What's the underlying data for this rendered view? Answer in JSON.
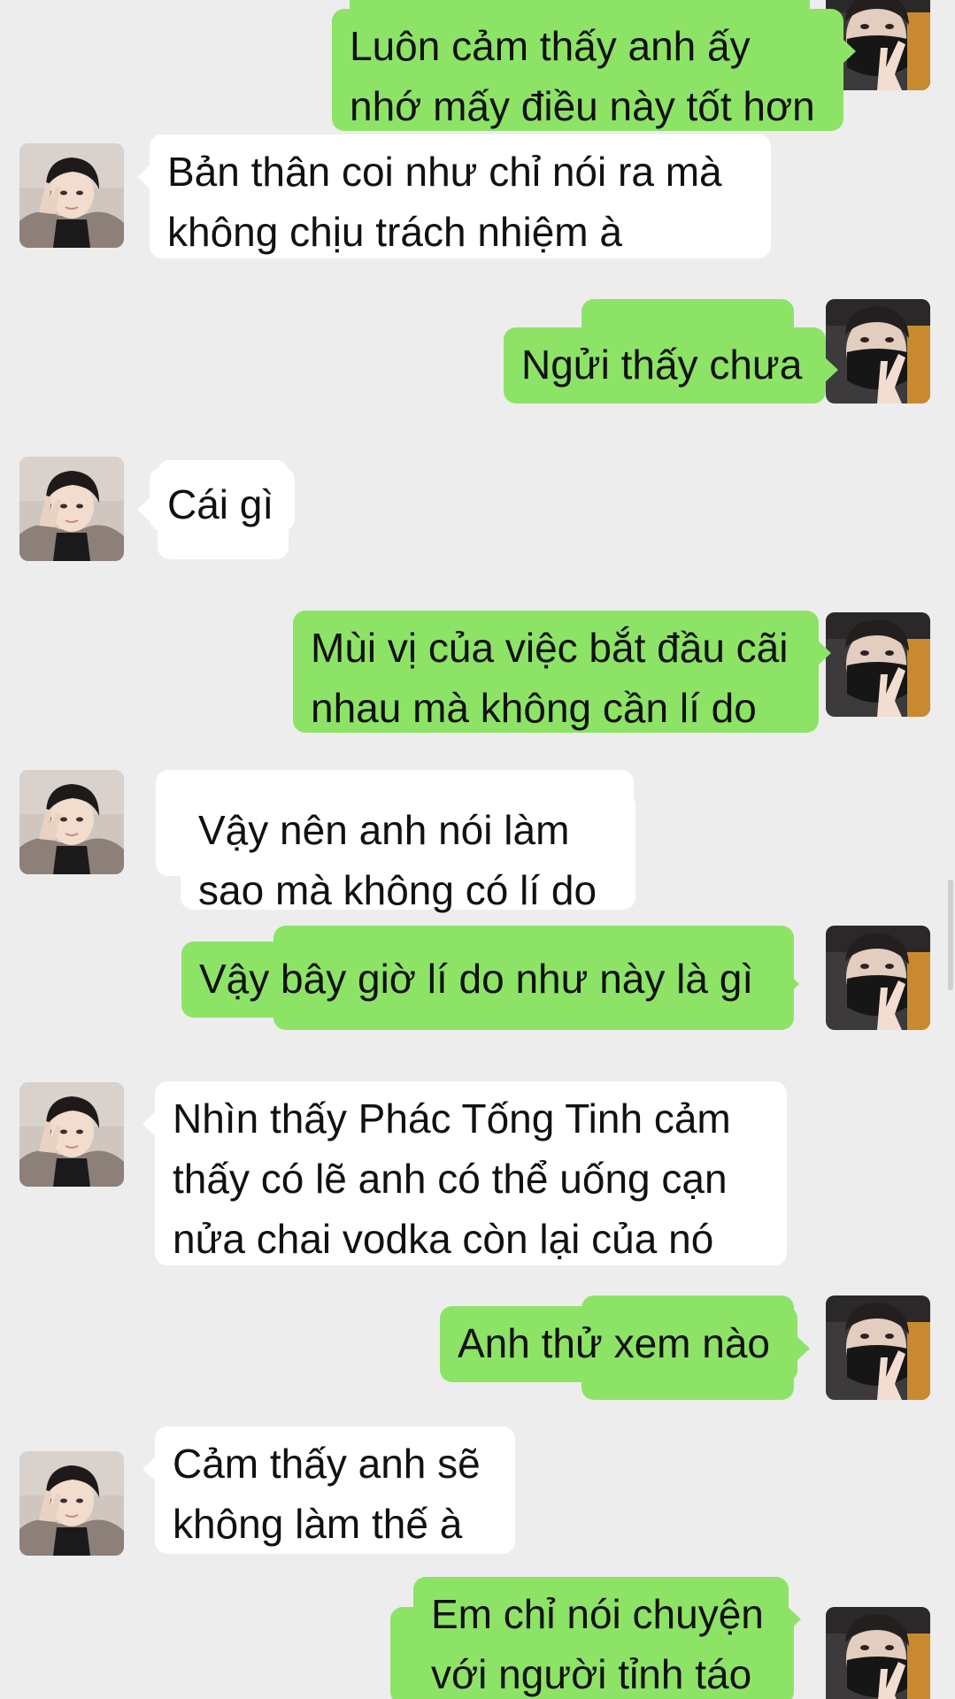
{
  "colors": {
    "background": "#EDEDED",
    "outgoing_bubble": "#8DE366",
    "incoming_bubble": "#FFFFFF",
    "text": "#111111"
  },
  "messages": [
    {
      "side": "out",
      "text": "Luôn cảm thấy anh ấy\nnhớ mấy điều này tốt hơn"
    },
    {
      "side": "in",
      "text": "Bản thân coi như chỉ nói ra mà\nkhông chịu trách nhiệm à"
    },
    {
      "side": "out",
      "text": "Ngửi thấy chưa"
    },
    {
      "side": "in",
      "text": "Cái gì"
    },
    {
      "side": "out",
      "text": "Mùi vị của việc bắt đầu cãi\nnhau mà không cần lí do"
    },
    {
      "side": "in",
      "text": "Vậy nên anh nói làm\nsao mà không có lí do"
    },
    {
      "side": "out",
      "text": "Vậy bây giờ lí do như này là gì"
    },
    {
      "side": "in",
      "text": "Nhìn thấy Phác Tống Tinh cảm\nthấy có lẽ anh có thể uống cạn\nnửa chai vodka còn lại của nó"
    },
    {
      "side": "out",
      "text": "Anh thử xem nào"
    },
    {
      "side": "in",
      "text": "Cảm thấy anh sẽ\nkhông làm thế à"
    },
    {
      "side": "out",
      "text": "Em chỉ nói chuyện\nvới người tỉnh táo"
    }
  ],
  "icons": {
    "left_avatar": "avatar-dark-hair-peace-sign",
    "right_avatar": "avatar-black-mask-peace-sign"
  }
}
